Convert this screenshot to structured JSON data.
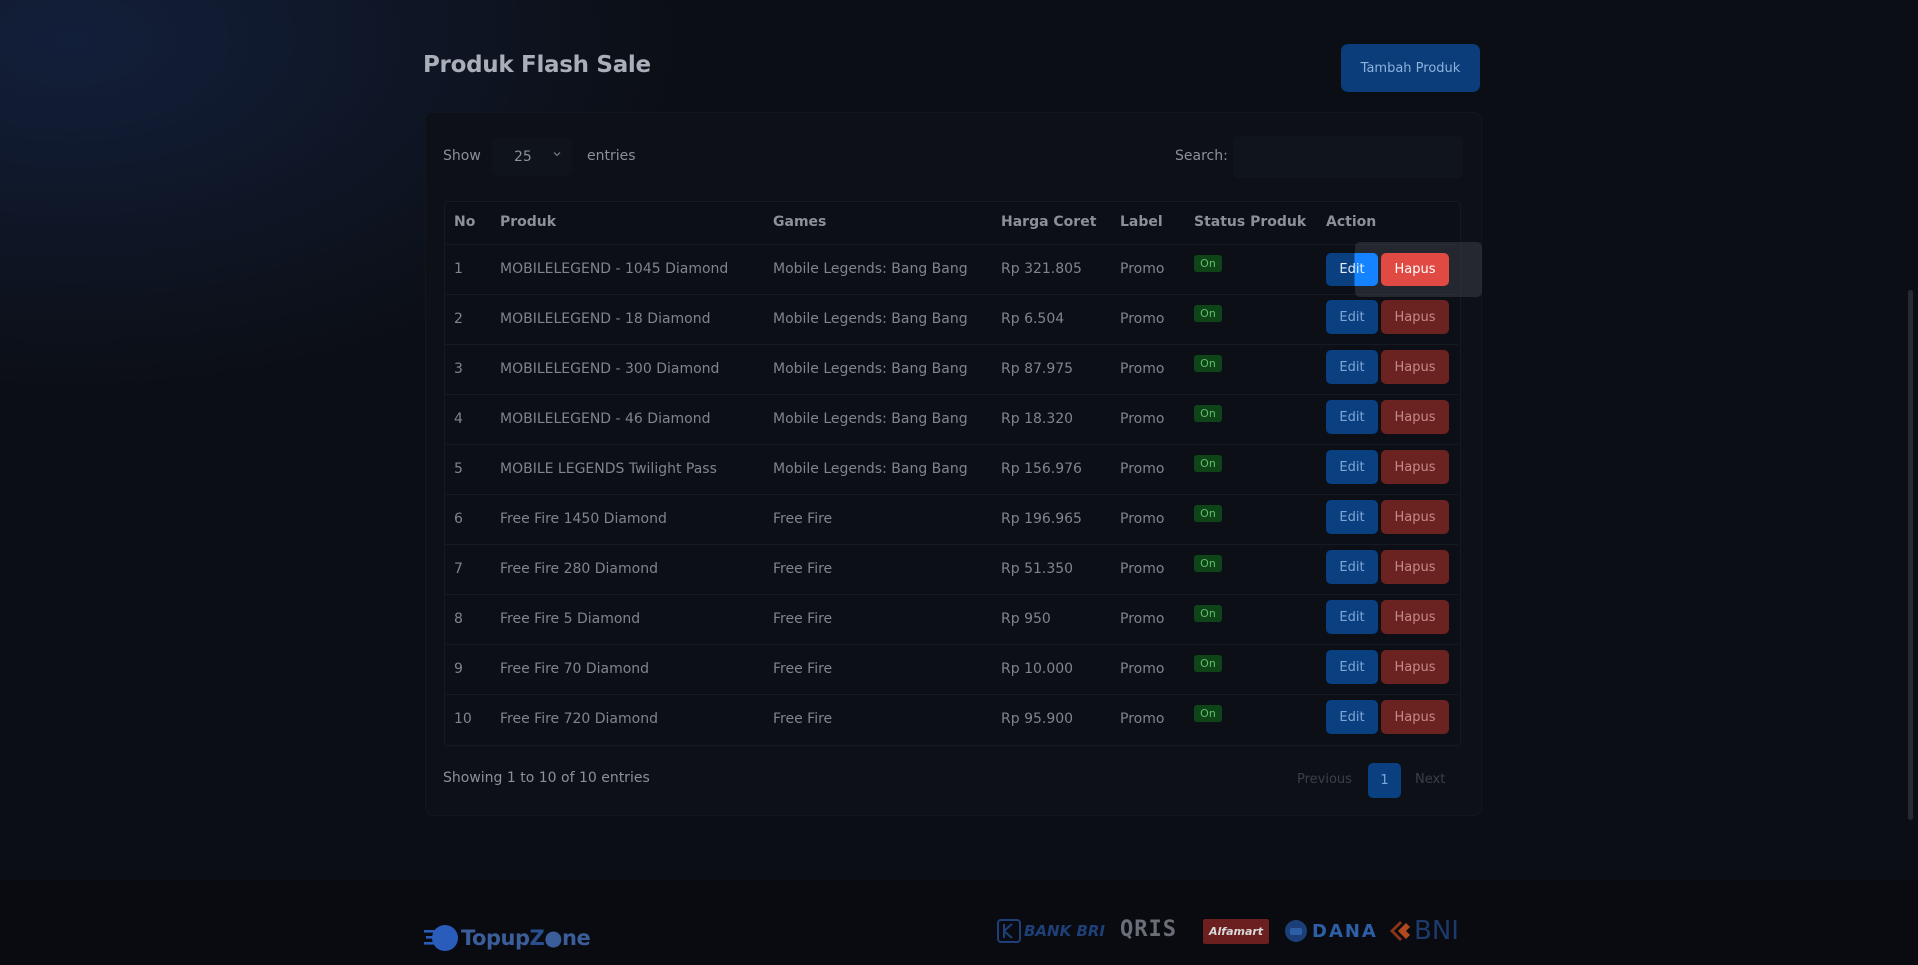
{
  "page": {
    "title": "Produk Flash Sale",
    "add_button": "Tambah Produk"
  },
  "controls": {
    "show_label": "Show",
    "entries_value": "25",
    "entries_label": "entries",
    "search_label": "Search:",
    "search_value": ""
  },
  "table": {
    "headers": {
      "no": "No",
      "produk": "Produk",
      "games": "Games",
      "harga_coret": "Harga Coret",
      "label": "Label",
      "status": "Status Produk",
      "action": "Action"
    },
    "edit_label": "Edit",
    "delete_label": "Hapus",
    "rows": [
      {
        "no": "1",
        "produk": "MOBILELEGEND - 1045 Diamond",
        "games": "Mobile Legends: Bang Bang",
        "harga": "Rp 321.805",
        "label": "Promo",
        "status": "On"
      },
      {
        "no": "2",
        "produk": "MOBILELEGEND - 18 Diamond",
        "games": "Mobile Legends: Bang Bang",
        "harga": "Rp 6.504",
        "label": "Promo",
        "status": "On"
      },
      {
        "no": "3",
        "produk": "MOBILELEGEND - 300 Diamond",
        "games": "Mobile Legends: Bang Bang",
        "harga": "Rp 87.975",
        "label": "Promo",
        "status": "On"
      },
      {
        "no": "4",
        "produk": "MOBILELEGEND - 46 Diamond",
        "games": "Mobile Legends: Bang Bang",
        "harga": "Rp 18.320",
        "label": "Promo",
        "status": "On"
      },
      {
        "no": "5",
        "produk": "MOBILE LEGENDS Twilight Pass",
        "games": "Mobile Legends: Bang Bang",
        "harga": "Rp 156.976",
        "label": "Promo",
        "status": "On"
      },
      {
        "no": "6",
        "produk": "Free Fire 1450 Diamond",
        "games": "Free Fire",
        "harga": "Rp 196.965",
        "label": "Promo",
        "status": "On"
      },
      {
        "no": "7",
        "produk": "Free Fire 280 Diamond",
        "games": "Free Fire",
        "harga": "Rp 51.350",
        "label": "Promo",
        "status": "On"
      },
      {
        "no": "8",
        "produk": "Free Fire 5 Diamond",
        "games": "Free Fire",
        "harga": "Rp 950",
        "label": "Promo",
        "status": "On"
      },
      {
        "no": "9",
        "produk": "Free Fire 70 Diamond",
        "games": "Free Fire",
        "harga": "Rp 10.000",
        "label": "Promo",
        "status": "On"
      },
      {
        "no": "10",
        "produk": "Free Fire 720 Diamond",
        "games": "Free Fire",
        "harga": "Rp 95.900",
        "label": "Promo",
        "status": "On"
      }
    ]
  },
  "pagination": {
    "info": "Showing 1 to 10 of 10 entries",
    "prev": "Previous",
    "current": "1",
    "next": "Next"
  },
  "footer": {
    "logo_a": "Topup",
    "logo_b": "Z",
    "logo_c": "ne",
    "payments": {
      "bri": "BANK BRI",
      "qris": "QRIS",
      "alfamart": "Alfamart",
      "dana": "DANA",
      "bni": "BNI"
    }
  },
  "colors": {
    "primary": "#0a3f80",
    "danger": "#e04a43",
    "success": "#0f4418",
    "background": "#0b0e14"
  },
  "icons": {
    "select": "chevron-down-icon",
    "logo": "topupzone-logo-icon",
    "dana": "dana-logo-icon",
    "bni": "bni-logo-icon"
  }
}
